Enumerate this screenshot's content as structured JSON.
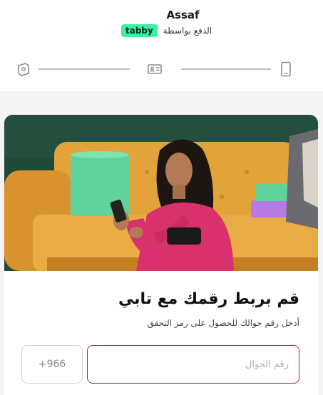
{
  "header": {
    "merchant_name": "Assaf",
    "pay_via_text": "الدفع بواسطة",
    "provider_badge": "tabby"
  },
  "steps": {
    "icons": [
      "id-card-icon",
      "contact-card-icon",
      "phone-icon"
    ]
  },
  "verification": {
    "title": "قم بربط رقمك مع تابي",
    "subtitle": "أدخل رقم جوالك للحصول على رمز التحقق",
    "phone_placeholder": "رقم الجوال",
    "phone_value": "",
    "country_code": "+966"
  },
  "colors": {
    "brand_green": "#3bf0a1",
    "input_border": "#9e2a4b",
    "hero_background": "#1f4a3a",
    "sofa": "#e3a33b",
    "shirt": "#d8316b"
  }
}
